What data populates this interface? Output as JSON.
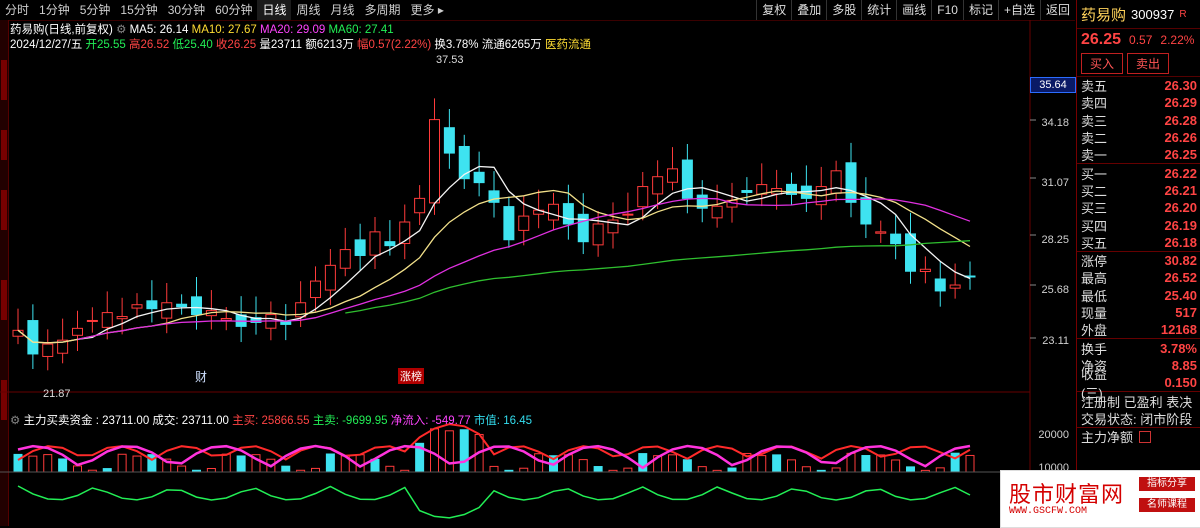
{
  "toolbar": {
    "tabs": [
      "分时",
      "1分钟",
      "5分钟",
      "15分钟",
      "30分钟",
      "60分钟",
      "日线",
      "周线",
      "月线",
      "多周期",
      "更多 ▸"
    ],
    "right": [
      "复权",
      "叠加",
      "多股",
      "统计",
      "画线",
      "F10",
      "标记",
      "+自选",
      "返回"
    ]
  },
  "info": {
    "title": "药易购(日线,前复权)",
    "ma5": "MA5: 26.14",
    "ma10": "MA10: 27.67",
    "ma20": "MA20: 29.09",
    "ma60": "MA60: 27.41",
    "date": "2024/12/27/五",
    "open": "开25.55",
    "high": "高26.52",
    "low": "低25.40",
    "close": "收26.25",
    "vol": "量23711",
    "amount": "额6213万",
    "amp": "幅0.57(2.22%)",
    "turnover": "换3.78%",
    "float": "流通6265万",
    "sector": "医药流通"
  },
  "chart_labels": {
    "peak": "37.53",
    "trough": "21.87",
    "cai": "财",
    "zhangbang": "涨榜"
  },
  "price_tag": "35.64",
  "yaxis": [
    "34.18",
    "31.07",
    "28.25",
    "25.68",
    "23.11"
  ],
  "yaxis2": [
    "20000",
    "10000"
  ],
  "indicator": {
    "name": "主力买卖资金 : 23711.00",
    "chengjiao": "成交: 23711.00",
    "zhumai": "主买: 25866.55",
    "zhumai2": "主卖: -9699.95",
    "jingliu": "净流入: -549.77",
    "shizhi": "市值: 16.45"
  },
  "panel": {
    "name": "药易购",
    "code": "300937",
    "r": "R",
    "price": "26.25",
    "chg": "0.57",
    "pct": "2.22%",
    "buy": "买入",
    "sell": "卖出",
    "asks": [
      [
        "卖五",
        "26.30"
      ],
      [
        "卖四",
        "26.29"
      ],
      [
        "卖三",
        "26.28"
      ],
      [
        "卖二",
        "26.26"
      ],
      [
        "卖一",
        "26.25"
      ]
    ],
    "bids": [
      [
        "买一",
        "26.22"
      ],
      [
        "买二",
        "26.21"
      ],
      [
        "买三",
        "26.20"
      ],
      [
        "买四",
        "26.19"
      ],
      [
        "买五",
        "26.18"
      ]
    ],
    "stats": [
      [
        "涨停",
        "30.82"
      ],
      [
        "最高",
        "26.52"
      ],
      [
        "最低",
        "25.40"
      ],
      [
        "现量",
        "517"
      ],
      [
        "外盘",
        "12168"
      ]
    ],
    "stats2": [
      [
        "换手",
        "3.78%"
      ],
      [
        "净资",
        "8.85"
      ],
      [
        "收益(三)",
        "0.150"
      ]
    ],
    "line1": "注册制 已盈利 表决",
    "line2": "交易状态: 闭市阶段",
    "line3": "主力净额"
  },
  "watermark": {
    "big": "股市财富网",
    "url": "WWW.GSCFW.COM",
    "s1": "指标分享",
    "s2": "名师课程"
  }
}
